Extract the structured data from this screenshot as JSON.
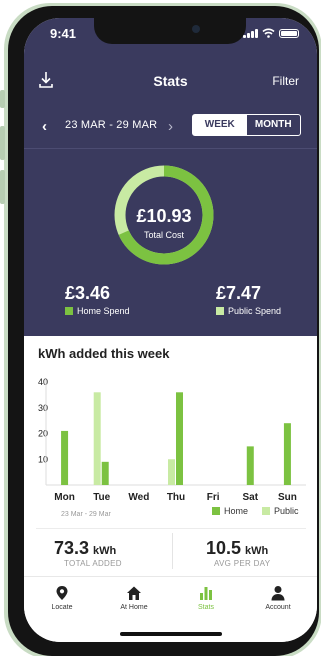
{
  "status_bar": {
    "time": "9:41"
  },
  "header": {
    "title": "Stats",
    "filter_label": "Filter",
    "download_icon": "download-icon"
  },
  "date_nav": {
    "range": "23 MAR - 29 MAR",
    "toggle": [
      "WEEK",
      "MONTH"
    ],
    "selected": "WEEK"
  },
  "summary": {
    "total_cost": "£10.93",
    "total_cost_label": "Total Cost",
    "home_share": 0.317,
    "home_spend": "£3.46",
    "home_spend_label": "Home Spend",
    "public_spend": "£7.47",
    "public_spend_label": "Public Spend"
  },
  "colors": {
    "home": "#7cc241",
    "public": "#c8eaa3",
    "dark": "#3a3a5e"
  },
  "usage": {
    "title": "kWh added this week",
    "sub_date": "23 Mar - 29 Mar"
  },
  "chart_data": {
    "type": "bar",
    "categories": [
      "Mon",
      "Tue",
      "Wed",
      "Thu",
      "Fri",
      "Sat",
      "Sun"
    ],
    "series": [
      {
        "name": "Home",
        "values": [
          21,
          9,
          0,
          36,
          0,
          15,
          24
        ]
      },
      {
        "name": "Public",
        "values": [
          0,
          36,
          0,
          10,
          0,
          0,
          0
        ]
      }
    ],
    "ylim": [
      0,
      40
    ],
    "yticks": [
      10,
      20,
      30,
      40
    ],
    "grid": false,
    "legend": "bottom-right"
  },
  "stats": {
    "total_added": "73.3",
    "total_unit": "kWh",
    "total_label": "TOTAL ADDED",
    "avg_per_day": "10.5",
    "avg_unit": "kWh",
    "avg_label": "AVG PER DAY"
  },
  "tabs": [
    {
      "label": "Locate",
      "icon": "location-pin-icon"
    },
    {
      "label": "At Home",
      "icon": "home-icon"
    },
    {
      "label": "Stats",
      "icon": "bar-chart-icon",
      "active": true
    },
    {
      "label": "Account",
      "icon": "user-icon"
    }
  ]
}
